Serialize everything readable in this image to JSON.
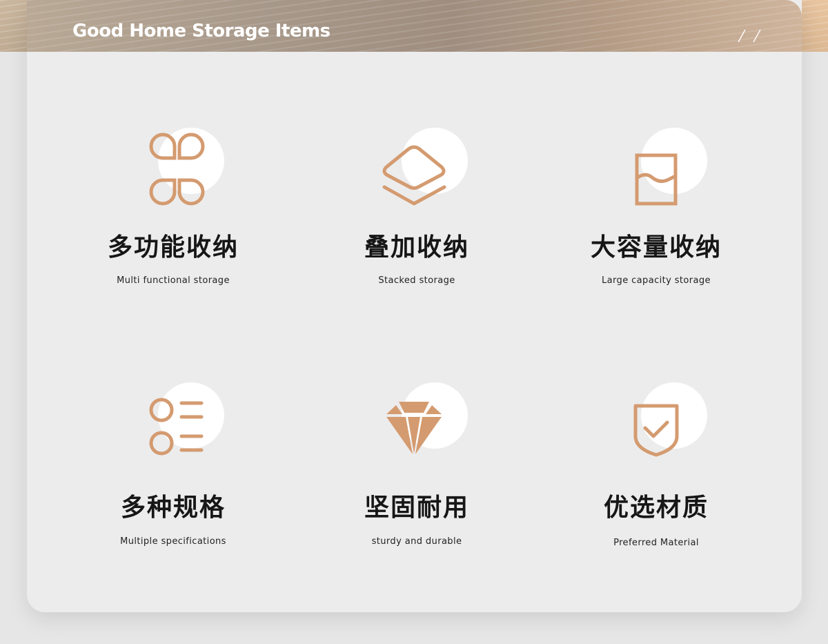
{
  "header": {
    "title": "Good Home Storage Items"
  },
  "colors": {
    "accent": "#d49b70",
    "card_bg": "#ececec",
    "icon_bg": "#ffffff",
    "title_text": "#161616"
  },
  "features": [
    {
      "icon": "clover-icon",
      "title": "多功能收纳",
      "subtitle": "Multi functional storage"
    },
    {
      "icon": "stacked-layers-icon",
      "title": "叠加收纳",
      "subtitle": "Stacked storage"
    },
    {
      "icon": "container-icon",
      "title": "大容量收纳",
      "subtitle": "Large capacity storage"
    },
    {
      "icon": "list-icon",
      "title": "多种规格",
      "subtitle": "Multiple specifications"
    },
    {
      "icon": "diamond-icon",
      "title": "坚固耐用",
      "subtitle": "sturdy and durable"
    },
    {
      "icon": "shield-check-icon",
      "title": "优选材质",
      "subtitle": "Preferred Material"
    }
  ]
}
